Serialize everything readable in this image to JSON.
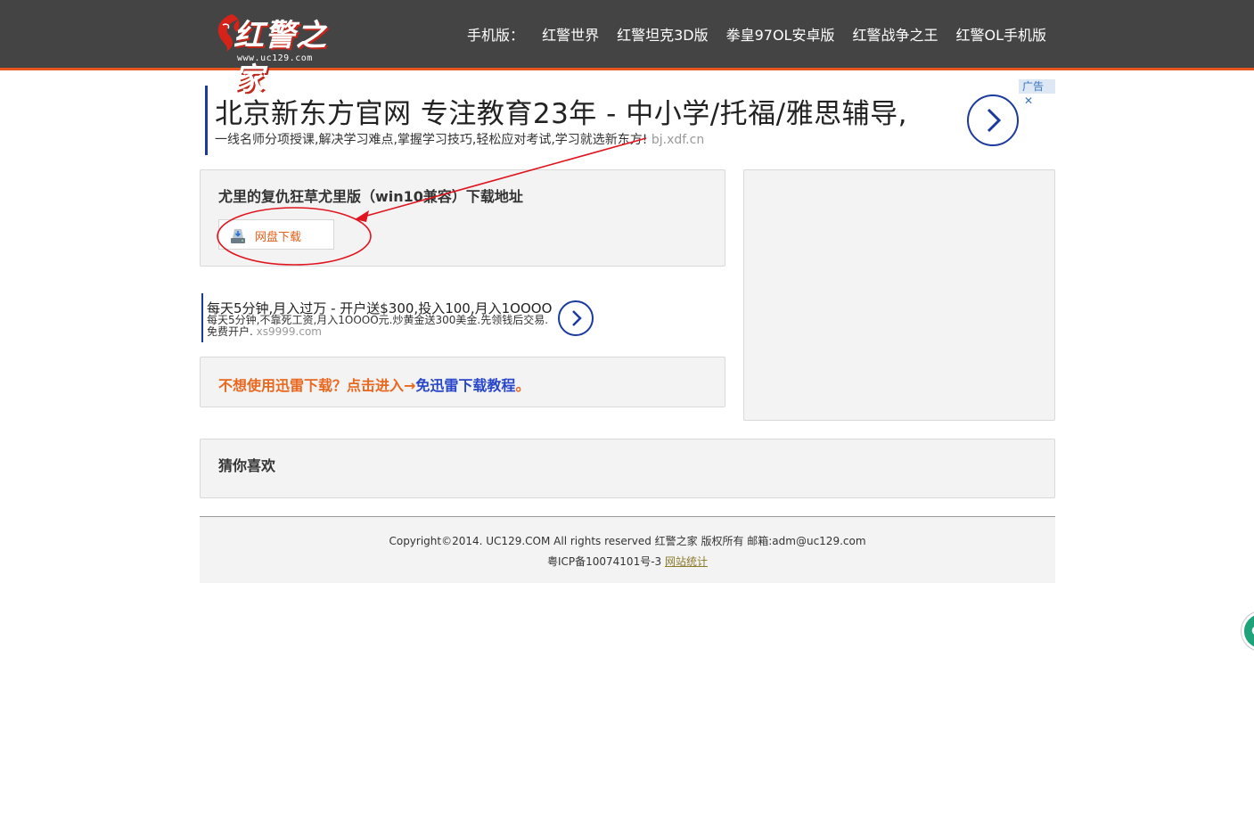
{
  "header": {
    "logo_text": "红警之家",
    "logo_url": "www.uc129.com",
    "nav_label": "手机版：",
    "nav_items": [
      "红警世界",
      "红警坦克3D版",
      "拳皇97OL安卓版",
      "红警战争之王",
      "红警OL手机版"
    ]
  },
  "ad_top": {
    "title": "北京新东方官网 专注教育23年 - 中小学/托福/雅思辅导,",
    "desc": "一线名师分项授课,解决学习难点,掌握学习技巧,轻松应对考试,学习就选新东方!",
    "domain": "bj.xdf.cn",
    "badge": "广告",
    "close": "✕"
  },
  "download": {
    "title": "尤里的复仇狂草尤里版（win10兼容）下载地址",
    "button_label": "网盘下载"
  },
  "ad_mid": {
    "title": "每天5分钟,月入过万 - 开户送$300,投入100,月入1OOOO",
    "desc": "每天5分钟,不靠死工资,月入1OOOO元.炒黄金送300美金.先领钱后交易.免费开户.",
    "domain": "xs9999.com"
  },
  "tip": {
    "prefix": "不想使用迅雷下载？点击进入→",
    "link": "免迅雷下载教程",
    "suffix": "。"
  },
  "guess": {
    "title": "猜你喜欢"
  },
  "footer": {
    "copyright": "Copyright©2014. UC129.COM All rights reserved 红警之家 版权所有 邮箱:adm@uc129.com",
    "icp": "粤ICP备10074101号-3",
    "stat_link": "网站统计"
  },
  "colors": {
    "header_bg": "#444444",
    "header_accent": "#e8561f",
    "annotation": "#e0141e",
    "link_blue": "#2746c9",
    "orange": "#e8681f"
  }
}
